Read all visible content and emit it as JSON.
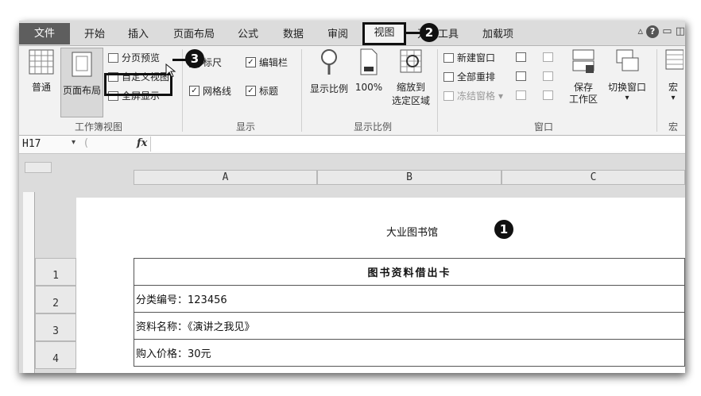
{
  "tabs": {
    "file": "文件",
    "items": [
      "开始",
      "插入",
      "页面布局",
      "公式",
      "数据",
      "审阅"
    ],
    "active": "视图",
    "after": [
      "开发工具",
      "加载项"
    ]
  },
  "ribbon": {
    "workbook_views": {
      "group_label": "工作簿视图",
      "normal": "普通",
      "page_layout": "页面布局",
      "page_break_preview": "分页预览",
      "custom_views": "自定义视图",
      "full_screen": "全屏显示"
    },
    "show": {
      "group_label": "显示",
      "ruler": "标尺",
      "formula_bar": "编辑栏",
      "gridlines": "网格线",
      "headings": "标题"
    },
    "zoom": {
      "group_label": "显示比例",
      "zoom": "显示比例",
      "hundred": "100%",
      "zoom_to_selection_1": "缩放到",
      "zoom_to_selection_2": "选定区域"
    },
    "window": {
      "group_label": "窗口",
      "new_window": "新建窗口",
      "arrange_all": "全部重排",
      "freeze_panes": "冻结窗格",
      "save_workspace_1": "保存",
      "save_workspace_2": "工作区",
      "switch_windows": "切换窗口"
    },
    "macros": {
      "group_label": "宏",
      "macros": "宏"
    }
  },
  "formula_bar": {
    "name_box": "H17",
    "fx": "fx"
  },
  "sheet": {
    "columns": [
      "A",
      "B",
      "C"
    ],
    "rows": [
      "1",
      "2",
      "3",
      "4"
    ],
    "page_header": "大业图书馆",
    "card_title": "图书资料借出卡",
    "cells": [
      "分类编号：123456",
      "资料名称：《演讲之我见》",
      "购入价格：30元"
    ]
  },
  "callouts": [
    "1",
    "2",
    "3"
  ]
}
